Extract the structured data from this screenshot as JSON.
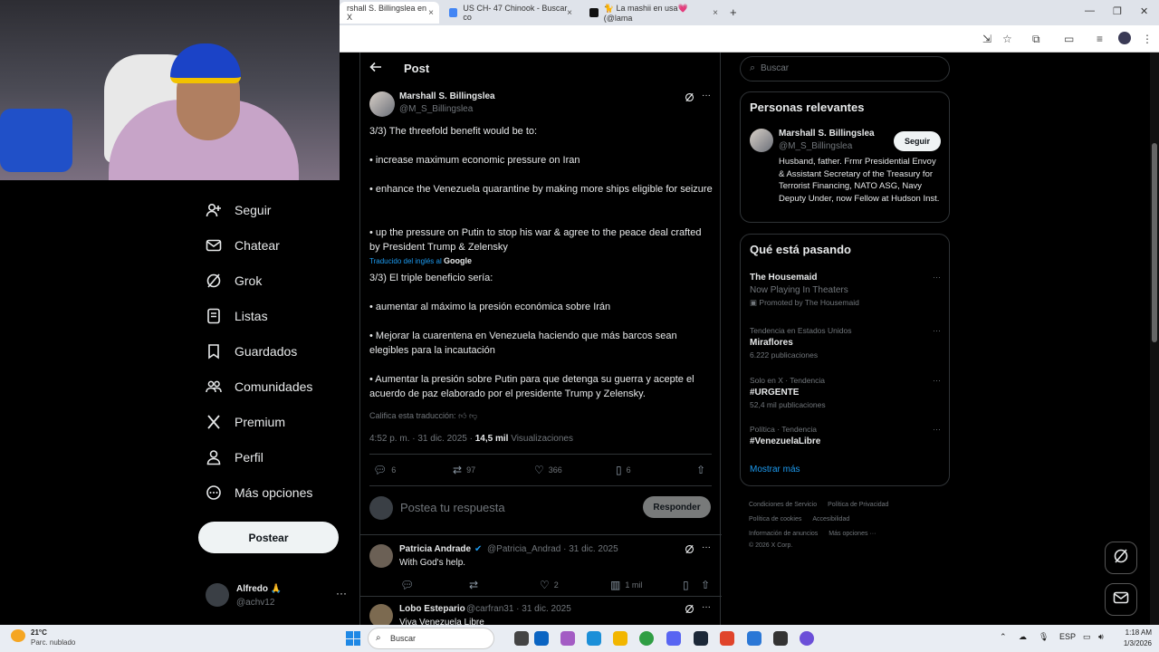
{
  "browser": {
    "tabs": [
      {
        "label": "rshall S. Billingslea en X"
      },
      {
        "label": "US CH- 47 Chinook - Buscar co"
      },
      {
        "label": "🐈 La mashii en usa💗 (@lama"
      }
    ],
    "tab_close": "×",
    "new_tab": "+",
    "window_controls": {
      "minimize": "—",
      "maximize": "❐",
      "close": "✕"
    }
  },
  "nav": {
    "items": [
      {
        "label": "Seguir",
        "icon": "person-add-icon"
      },
      {
        "label": "Chatear",
        "icon": "mail-icon"
      },
      {
        "label": "Grok",
        "icon": "grok-icon"
      },
      {
        "label": "Listas",
        "icon": "list-icon"
      },
      {
        "label": "Guardados",
        "icon": "bookmark-icon"
      },
      {
        "label": "Comunidades",
        "icon": "communities-icon"
      },
      {
        "label": "Premium",
        "icon": "x-logo-icon"
      },
      {
        "label": "Perfil",
        "icon": "profile-icon"
      },
      {
        "label": "Más opciones",
        "icon": "more-circle-icon"
      }
    ],
    "post_button": "Postear",
    "account": {
      "name": "Alfredo 🙏",
      "handle": "@achv12",
      "more": "···"
    }
  },
  "post": {
    "header_title": "Post",
    "author_name": "Marshall S. Billingslea",
    "author_handle": "@M_S_Billingslea",
    "original_paragraphs": [
      "3/3) The threefold benefit would be to:",
      "• increase maximum economic pressure on Iran",
      "• enhance the Venezuela quarantine by making more ships eligible for seizure",
      "• up the pressure on Putin to stop his war & agree to the peace deal crafted by President Trump & Zelensky"
    ],
    "translated_by": "Traducido del inglés al",
    "translated_service": "Google",
    "translated_paragraphs": [
      "3/3) El triple beneficio sería:",
      "• aumentar al máximo la presión económica sobre Irán",
      "• Mejorar la cuarentena en Venezuela haciendo que más barcos sean elegibles para la incautación",
      "• Aumentar la presión sobre Putin para que detenga su guerra y acepte el acuerdo de paz elaborado por el presidente Trump y Zelensky."
    ],
    "rate_translation": "Califica esta traducción:",
    "time": "4:52 p. m. · 31 dic. 2025 · ",
    "views_count": "14,5 mil",
    "views_label": " Visualizaciones",
    "stats": {
      "replies": "6",
      "reposts": "97",
      "likes": "366",
      "bookmarks": "6"
    },
    "reply_placeholder": "Postea tu respuesta",
    "reply_button": "Responder"
  },
  "comments": [
    {
      "name": "Patricia Andrade",
      "handle": "@Patricia_Andrad · 31 dic. 2025",
      "text": "With God's help.",
      "likes": "2",
      "views": "1 mil"
    },
    {
      "name": "Lobo Estepario",
      "handle": "@carfran31 · 31 dic. 2025",
      "text": "Viva Venezuela Libre"
    }
  ],
  "right": {
    "search_placeholder": "Buscar",
    "relevant_title": "Personas relevantes",
    "relevant_name": "Marshall S. Billingslea",
    "relevant_handle": "@M_S_Billingslea",
    "follow_button": "Seguir",
    "relevant_bio": "Husband, father. Frmr Presidential Envoy & Assistant Secretary of the Treasury for Terrorist Financing, NATO ASG, Navy Deputy Under, now Fellow at Hudson Inst.",
    "trends_title": "Qué está pasando",
    "trends": [
      {
        "context": "",
        "name": "The Housemaid",
        "count": "Now Playing In Theaters",
        "promo": "Promoted by The Housemaid"
      },
      {
        "context": "Tendencia en Estados Unidos",
        "name": "Miraflores",
        "count": "6.222 publicaciones",
        "promo": ""
      },
      {
        "context": "Solo en X · Tendencia",
        "name": "#URGENTE",
        "count": "52,4 mil publicaciones",
        "promo": ""
      },
      {
        "context": "Política · Tendencia",
        "name": "#VenezuelaLibre",
        "count": "",
        "promo": ""
      }
    ],
    "show_more": "Mostrar más",
    "footer": [
      "Condiciones de Servicio",
      "Política de Privacidad",
      "Política de cookies",
      "Accesibilidad",
      "Información de anuncios",
      "Más opciones ···",
      "© 2026 X Corp."
    ]
  },
  "taskbar": {
    "temp": "21°C",
    "weather": "Parc. nublado",
    "search": "Buscar",
    "lang": "ESP",
    "time": "1:18 AM",
    "date": "1/3/2026"
  }
}
